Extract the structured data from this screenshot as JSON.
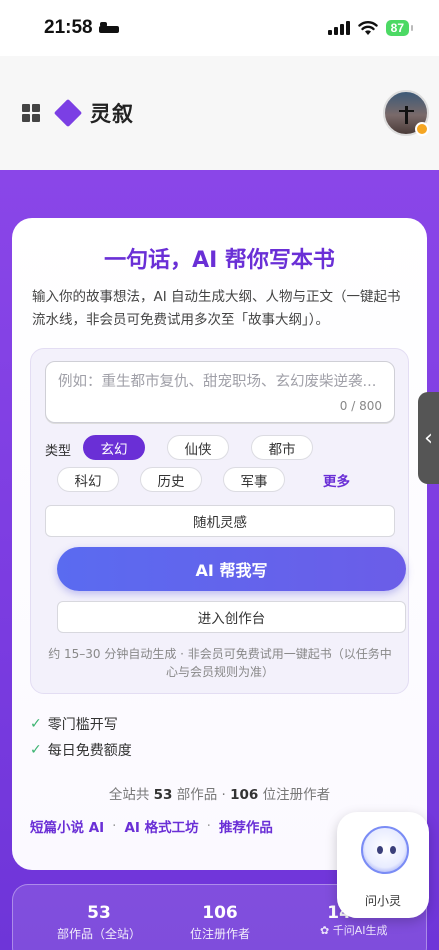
{
  "status_bar": {
    "time": "21:58",
    "battery": "87"
  },
  "header": {
    "app_name": "灵叙"
  },
  "card": {
    "title": "一句话，AI 帮你写本书",
    "description": "输入你的故事想法，AI 自动生成大纲、人物与正文（一键起书流水线，非会员可免费试用多次至「故事大纲」）。",
    "input": {
      "placeholder": "例如：重生都市复仇、甜宠职场、玄幻废柴逆袭...",
      "counter": "0 / 800"
    },
    "type_label": "类型",
    "chips": [
      "玄幻",
      "仙侠",
      "都市",
      "科幻",
      "历史",
      "军事"
    ],
    "more": "更多",
    "random_btn": "随机灵感",
    "ai_btn": "AI 帮我写",
    "studio_btn": "进入创作台",
    "note": "约 15–30 分钟自动生成 · 非会员可免费试用一键起书（以任务中心与会员规则为准）",
    "features": [
      "零门槛开写",
      "每日免费额度"
    ],
    "stats": {
      "prefix": "全站共",
      "works": "53",
      "works_unit": "部作品 ·",
      "authors": "106",
      "authors_unit": "位注册作者"
    },
    "links": [
      "短篇小说 AI",
      "AI 格式工坊",
      "推荐作品"
    ]
  },
  "bottom_stats": [
    {
      "num": "53",
      "label": "部作品（全站）"
    },
    {
      "num": "106",
      "label": "位注册作者"
    },
    {
      "num": "143",
      "label": ""
    }
  ],
  "assistant": {
    "label": "问小灵"
  },
  "watermark": "千问AI生成",
  "colors": {
    "accent": "#6a2fd6",
    "primary_btn": "#5a6bf0",
    "background": "#7a3be0"
  }
}
